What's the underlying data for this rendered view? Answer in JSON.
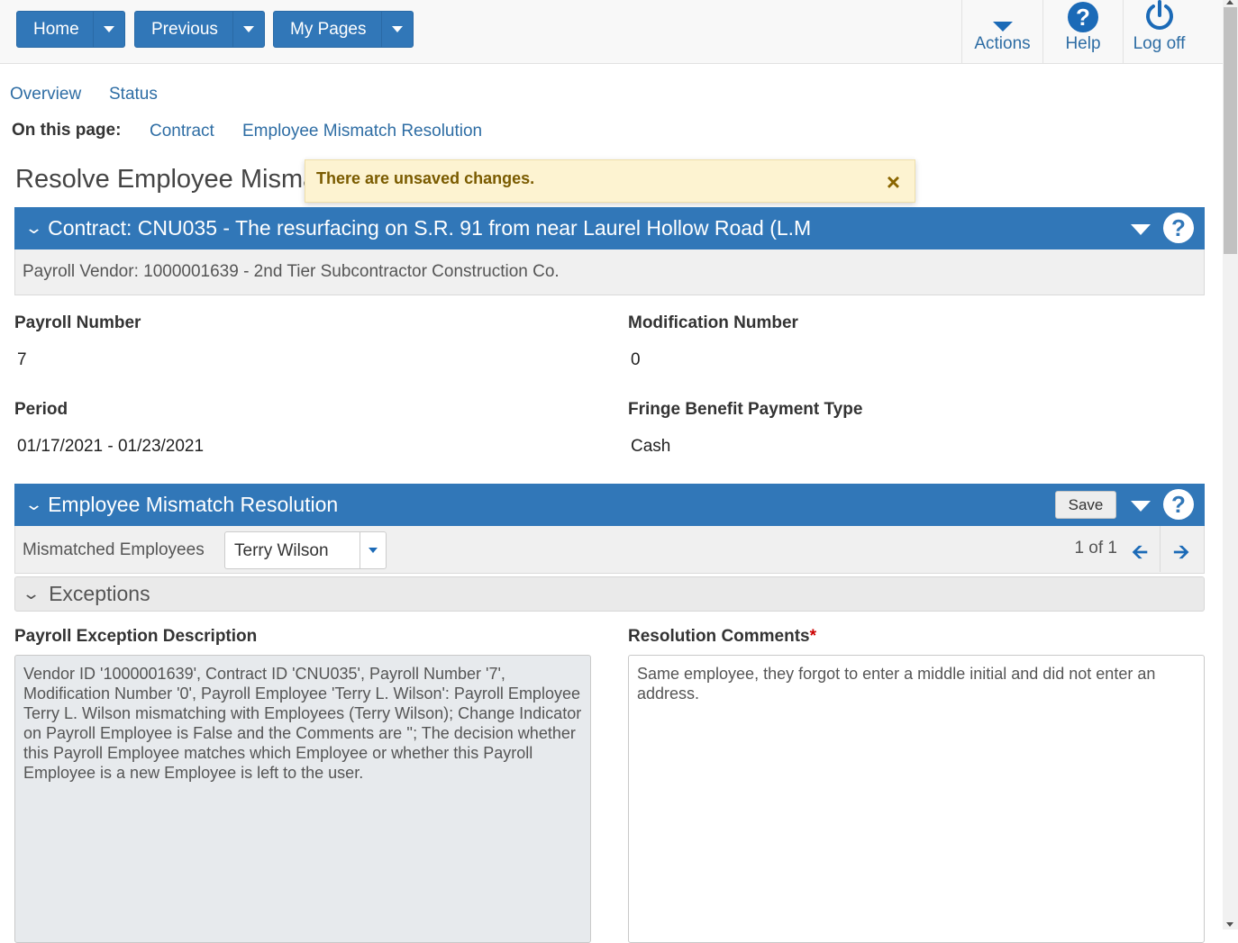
{
  "topbar": {
    "home_label": "Home",
    "previous_label": "Previous",
    "mypages_label": "My Pages",
    "actions_label": "Actions",
    "help_label": "Help",
    "logoff_label": "Log off"
  },
  "tabs": {
    "overview": "Overview",
    "status": "Status"
  },
  "on_this_page": {
    "label": "On this page:",
    "contract": "Contract",
    "mismatch": "Employee Mismatch Resolution"
  },
  "page_title": "Resolve Employee Mismatches",
  "toast": {
    "message": "There are unsaved changes.",
    "close": "×"
  },
  "contract_panel": {
    "title": "Contract: CNU035 - The resurfacing on S.R. 91 from near Laurel Hollow Road (L.M",
    "vendor": "Payroll Vendor: 1000001639 - 2nd Tier Subcontractor Construction Co."
  },
  "fields": {
    "payroll_number_label": "Payroll Number",
    "payroll_number": "7",
    "modification_number_label": "Modification Number",
    "modification_number": "0",
    "period_label": "Period",
    "period": "01/17/2021 - 01/23/2021",
    "fringe_label": "Fringe Benefit Payment Type",
    "fringe": "Cash"
  },
  "mismatch_panel": {
    "title": "Employee Mismatch Resolution",
    "save_label": "Save",
    "mismatched_label": "Mismatched Employees",
    "selected_employee": "Terry Wilson",
    "pager": "1 of 1"
  },
  "exceptions": {
    "title": "Exceptions",
    "description_label": "Payroll Exception Description",
    "description": "Vendor ID '1000001639', Contract ID 'CNU035', Payroll Number '7', Modification Number '0', Payroll Employee 'Terry L. Wilson': Payroll Employee Terry L. Wilson mismatching with Employees (Terry Wilson); Change Indicator on Payroll Employee is False and the Comments are ''; The decision whether this Payroll Employee matches which Employee or whether this Payroll Employee is a new Employee is left to the user.",
    "comments_label": "Resolution Comments",
    "required_mark": "*",
    "comments": "Same employee, they forgot to enter a middle initial and did not enter an address."
  }
}
